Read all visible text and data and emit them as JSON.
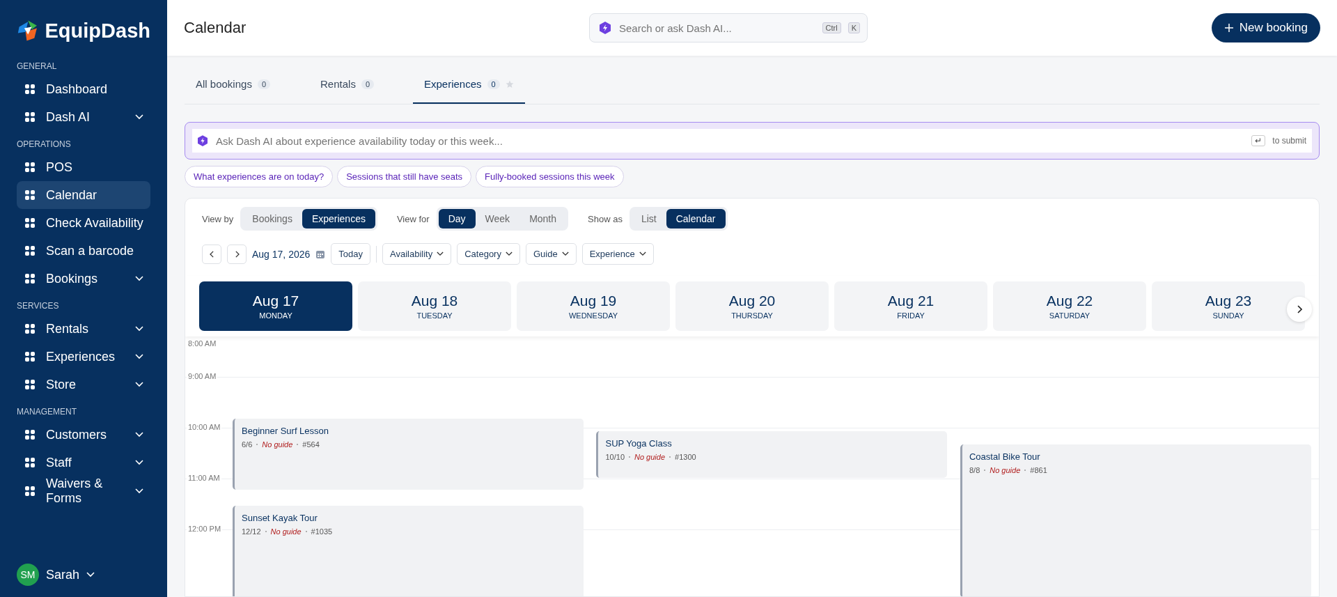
{
  "sidebar": {
    "brand": "EquipDash",
    "sections": [
      {
        "heading": "GENERAL",
        "items": [
          {
            "label": "Dashboard",
            "expandable": false,
            "selected": false
          },
          {
            "label": "Dash AI",
            "expandable": true,
            "selected": false
          }
        ]
      },
      {
        "heading": "OPERATIONS",
        "items": [
          {
            "label": "POS",
            "expandable": false,
            "selected": false
          },
          {
            "label": "Calendar",
            "expandable": false,
            "selected": true
          },
          {
            "label": "Check Availability",
            "expandable": false,
            "selected": false
          },
          {
            "label": "Scan a barcode",
            "expandable": false,
            "selected": false
          },
          {
            "label": "Bookings",
            "expandable": true,
            "selected": false
          }
        ]
      },
      {
        "heading": "SERVICES",
        "items": [
          {
            "label": "Rentals",
            "expandable": true,
            "selected": false
          },
          {
            "label": "Experiences",
            "expandable": true,
            "selected": false
          },
          {
            "label": "Store",
            "expandable": true,
            "selected": false
          }
        ]
      },
      {
        "heading": "MANAGEMENT",
        "items": [
          {
            "label": "Customers",
            "expandable": true,
            "selected": false
          },
          {
            "label": "Staff",
            "expandable": true,
            "selected": false
          },
          {
            "label": "Waivers & Forms",
            "expandable": true,
            "selected": false
          }
        ]
      }
    ],
    "user": {
      "initials": "SM",
      "name": "Sarah"
    }
  },
  "header": {
    "title": "Calendar",
    "search": {
      "placeholder": "Search or ask Dash AI...",
      "keys": [
        "Ctrl",
        "K"
      ]
    },
    "new_button": "New booking"
  },
  "tabs": [
    {
      "label": "All bookings",
      "count": "0",
      "selected": false
    },
    {
      "label": "Rentals",
      "count": "0",
      "selected": false
    },
    {
      "label": "Experiences",
      "count": "0",
      "selected": true
    }
  ],
  "ai_prompt": {
    "placeholder": "Ask Dash AI about experience availability today or this week...",
    "key": "↵",
    "submit_hint": "to submit"
  },
  "suggestions": [
    "What experiences are on today?",
    "Sessions that still have seats",
    "Fully-booked sessions this week"
  ],
  "toggles": [
    {
      "label": "View by",
      "options": [
        {
          "label": "Bookings",
          "selected": false
        },
        {
          "label": "Experiences",
          "selected": true
        }
      ]
    },
    {
      "label": "View for",
      "options": [
        {
          "label": "Day",
          "selected": true
        },
        {
          "label": "Week",
          "selected": false
        },
        {
          "label": "Month",
          "selected": false
        }
      ]
    },
    {
      "label": "Show as",
      "options": [
        {
          "label": "List",
          "selected": false
        },
        {
          "label": "Calendar",
          "selected": true
        }
      ]
    }
  ],
  "date_nav": {
    "date": "Aug 17, 2026",
    "today": "Today"
  },
  "filters": [
    "Availability",
    "Category",
    "Guide",
    "Experience"
  ],
  "days": [
    {
      "date": "Aug 17",
      "weekday": "MONDAY",
      "selected": true
    },
    {
      "date": "Aug 18",
      "weekday": "TUESDAY",
      "selected": false
    },
    {
      "date": "Aug 19",
      "weekday": "WEDNESDAY",
      "selected": false
    },
    {
      "date": "Aug 20",
      "weekday": "THURSDAY",
      "selected": false
    },
    {
      "date": "Aug 21",
      "weekday": "FRIDAY",
      "selected": false
    },
    {
      "date": "Aug 22",
      "weekday": "SATURDAY",
      "selected": false
    },
    {
      "date": "Aug 23",
      "weekday": "SUNDAY",
      "selected": false
    }
  ],
  "hours": [
    "8:00 AM",
    "9:00 AM",
    "10:00 AM",
    "11:00 AM",
    "12:00 PM"
  ],
  "events": [
    {
      "title": "Beginner Surf Lesson",
      "seats": "6/6",
      "guide": "No guide",
      "ref": "#564"
    },
    {
      "title": "SUP Yoga Class",
      "seats": "10/10",
      "guide": "No guide",
      "ref": "#1300"
    },
    {
      "title": "Coastal Bike Tour",
      "seats": "8/8",
      "guide": "No guide",
      "ref": "#861"
    },
    {
      "title": "Sunset Kayak Tour",
      "seats": "12/12",
      "guide": "No guide",
      "ref": "#1035"
    }
  ]
}
